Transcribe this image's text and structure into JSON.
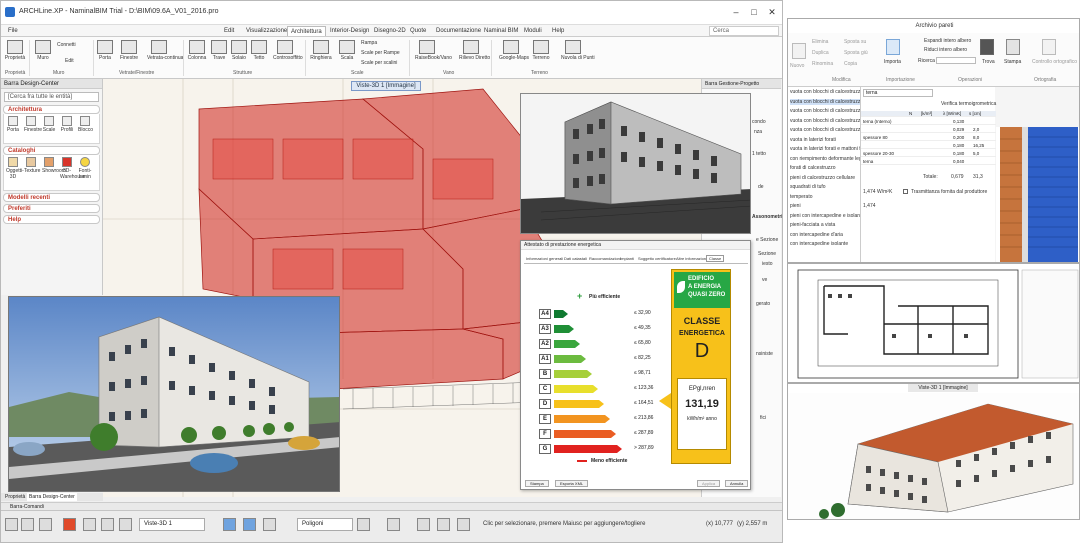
{
  "main_window": {
    "title": "ARCHLine.XP - NaminalBIM Trial - D:\\BIM\\09.6A_V01_2016.pro",
    "menu": [
      "File",
      "Edit",
      "Visualizzazione",
      "Architettura",
      "Interior-Design",
      "Disegno-2D",
      "Quote",
      "Documentazione",
      "Naminal BIM",
      "Moduli",
      "Help"
    ],
    "active_menu": "Architettura",
    "search_placeholder": "Cerca",
    "ribbon_buttons": [
      "Proprietà",
      "Muro",
      "Modifica",
      "Porta",
      "Finestre",
      "Vetrata-continua",
      "Colonna",
      "Trave",
      "Solaio",
      "Tetto",
      "Controsoffitto",
      "Ringhiera",
      "Scala",
      "RaiseBook/Vano",
      "Rilievo Diretto",
      "Google-Maps",
      "Terreno",
      "Nuvola di Punti"
    ],
    "ribbon_small": [
      "Connetti",
      "Edit",
      "Rampa",
      "Scale per Rampe",
      "Scale per scalini"
    ],
    "ribbon_groups": [
      "Proprietà",
      "Muro",
      "Vetrate/Finestre",
      "Strutture",
      "Scale",
      "Vano",
      "Terreno"
    ]
  },
  "left_panel": {
    "title": "Barra Design-Center",
    "search_placeholder": "[Cerca fra tutte le entità]",
    "sections": {
      "architettura": "Architettura",
      "cataloghi": "Cataloghi",
      "modelli": "Modelli recenti",
      "preferiti": "Preferiti",
      "help": "Help"
    },
    "arch_items": [
      "Porta",
      "Finestre",
      "Scale",
      "Profili",
      "Blocco"
    ],
    "cat_items": [
      "Oggetti-3D",
      "Texture",
      "Showroom",
      "3D-Warehouse",
      "Fonti-lumin"
    ]
  },
  "viewport": {
    "tab": "Viste-3D 1 [Immagine]",
    "right_panel_title": "Barra Gestione-Progetto",
    "project_texts": [
      "condo",
      "nza",
      "1 tetto",
      "de",
      "Assonometri",
      "e Sezione",
      "Sezione",
      "iesto",
      "ve",
      "gerato",
      "nsiniste",
      "fici"
    ]
  },
  "bottom": {
    "tabs": [
      "Proprietà",
      "Barra Design-Center"
    ],
    "cmd_label": "Barra-Comandi",
    "view_select": "Viste-3D 1",
    "poly_select": "Poligoni",
    "status_text": "Clic per selezionare, premere Maiusc per aggiungere/togliere",
    "coords": "(x) 10,777",
    "coords2": "(y) 2,557 m"
  },
  "energy": {
    "title": "Attestato di prestazione energetica",
    "tabs": [
      "Informazioni generali",
      "Dati catastali",
      "Raccomandazioni",
      "Impianti",
      "Soggetto certificatore",
      "Altre informazioni",
      "Classe"
    ],
    "active_tab": "Classe",
    "top_label": "Più efficiente",
    "bottom_label": "Meno efficiente",
    "bands": [
      {
        "code": "A4",
        "threshold": "≤ 32,90",
        "color": "#0f7a30"
      },
      {
        "code": "A3",
        "threshold": "≤ 49,35",
        "color": "#1f8f36"
      },
      {
        "code": "A2",
        "threshold": "≤ 65,80",
        "color": "#3aa63d"
      },
      {
        "code": "A1",
        "threshold": "≤ 82,25",
        "color": "#6cbb3f"
      },
      {
        "code": "B",
        "threshold": "≤ 98,71",
        "color": "#a6cf3a"
      },
      {
        "code": "C",
        "threshold": "≤ 123,36",
        "color": "#e8df2c"
      },
      {
        "code": "D",
        "threshold": "≤ 164,51",
        "color": "#f7c11a"
      },
      {
        "code": "E",
        "threshold": "≤ 213,86",
        "color": "#f29420"
      },
      {
        "code": "F",
        "threshold": "≤ 287,89",
        "color": "#ea5d23"
      },
      {
        "code": "G",
        "threshold": "> 287,89",
        "color": "#e1221f"
      }
    ],
    "nzeb": [
      "EDIFICIO",
      "A ENERGIA",
      "QUASI ZERO"
    ],
    "classe_label": "CLASSE",
    "energetica_label": "ENERGETICA",
    "class_value": "D",
    "ep_label": "EPgl,nren",
    "ep_value": "131,19",
    "ep_unit": "kWh/m² anno",
    "buttons": [
      "Stampa",
      "Esporta XML",
      "Applica",
      "Annulla"
    ]
  },
  "archivio": {
    "title": "Archivio pareti",
    "ribbon": [
      "Nuovo",
      "Elimina",
      "Duplica",
      "Rinomina",
      "Sposta su",
      "Sposta giù",
      "Copia",
      "Importa",
      "Espandi intero albero",
      "Riduci intero albero",
      "Ricerca",
      "Trova",
      "Stampa",
      "Controllo ortografico"
    ],
    "groups": [
      "Modifica",
      "Importazione",
      "Operazioni",
      "Ortografia"
    ],
    "list": [
      "vuota con blocchi di calcestruzzo",
      "vuota con blocchi di calcestruzzo t",
      "vuota con blocchi di calcestruzzo",
      "vuota con blocchi di calcestruzzo",
      "vuota con blocchi di calcestruzzo",
      "vuota in laterizi forati",
      "vuota in laterizi forati e mattoni fac",
      "con riempimento deformante legato",
      "forati di calcestruzzo",
      "pieni di calcestruzzo cellulare",
      "squadrati di tufo",
      "temperato",
      "pieni",
      "pieni con intercapedine e isolante",
      "pieni-facciata a vista",
      "con intercapedine d'aria",
      "con intercapedine isolante"
    ],
    "table_header": [
      "",
      "N",
      "[k/m³]",
      "λ [W/mK]",
      "s [cm]"
    ],
    "table_rows": [
      [
        "terna (Interno)",
        "",
        "",
        "0,130",
        ""
      ],
      [
        "",
        "",
        "",
        "0,029",
        "2,0"
      ],
      [
        "spessore 80",
        "",
        "",
        "0,200",
        "8,0"
      ],
      [
        "",
        "",
        "",
        "0,180",
        "16,25"
      ],
      [
        "spessore 20-30",
        "",
        "",
        "0,180",
        "5,0"
      ],
      [
        "terna",
        "",
        "",
        "0,040",
        ""
      ]
    ],
    "totale_label": "Totale:",
    "totale_values": [
      "0,679",
      "31,3"
    ],
    "verifica_label": "Verifica termoigrometrica",
    "trasmittanza_label": "Trasmittanza fornita dal produttore",
    "layer_name": "terna",
    "u_values": [
      "1,474",
      "1,474"
    ],
    "u_unit": "W/m²K"
  },
  "view3d": {
    "tab": "Viste-3D 1 [Immagine]"
  },
  "colors": {
    "accent_red": "#d0201a",
    "ribbon_bg": "#fbfbfb",
    "active_tab": "#dde7f5"
  }
}
